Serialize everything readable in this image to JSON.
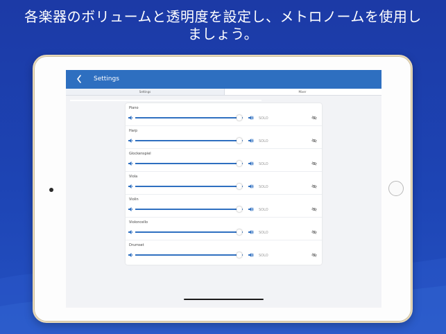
{
  "headline": "各楽器のボリュームと透明度を設定し、メトロノームを使用しましょう。",
  "navbar": {
    "title": "Settings",
    "back_icon": "chevron-left-icon"
  },
  "tabs": [
    {
      "label": "Settings"
    },
    {
      "label": "Mixer"
    }
  ],
  "solo_label": "SOLO",
  "colors": {
    "background": "#1d44b4",
    "navbar": "#2e6fc0",
    "slider": "#2e6fc0"
  },
  "instruments": [
    {
      "name": "Piano",
      "volume": 0.97
    },
    {
      "name": "Harp",
      "volume": 0.97
    },
    {
      "name": "Glockenspiel",
      "volume": 0.97
    },
    {
      "name": "Viola",
      "volume": 0.97
    },
    {
      "name": "Violin",
      "volume": 0.97
    },
    {
      "name": "Violoncello",
      "volume": 0.97
    },
    {
      "name": "Drumset",
      "volume": 0.97
    }
  ]
}
